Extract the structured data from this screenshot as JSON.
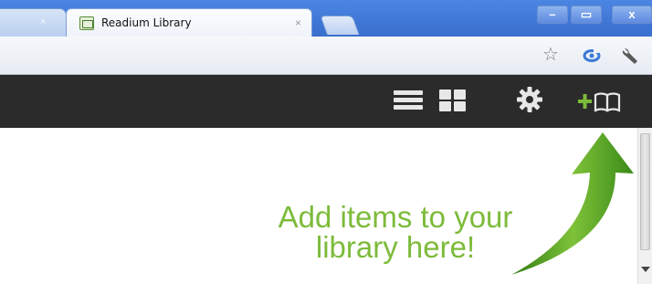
{
  "browser": {
    "tab_title": "Readium Library",
    "prev_tab_close": "×",
    "tab_close": "×",
    "window_buttons": {
      "minimize": "–",
      "maximize": "▭",
      "close": "x"
    }
  },
  "toolbar": {
    "icons": [
      "star-icon",
      "sync-icon",
      "wrench-icon"
    ]
  },
  "app": {
    "header_icons": [
      "list-view-icon",
      "grid-view-icon",
      "gear-icon",
      "add-book-icon"
    ],
    "add_plus": "+",
    "accent_color": "#7dbb3a"
  },
  "content": {
    "hint_line1": "Add items to your",
    "hint_line2": "library here!"
  }
}
